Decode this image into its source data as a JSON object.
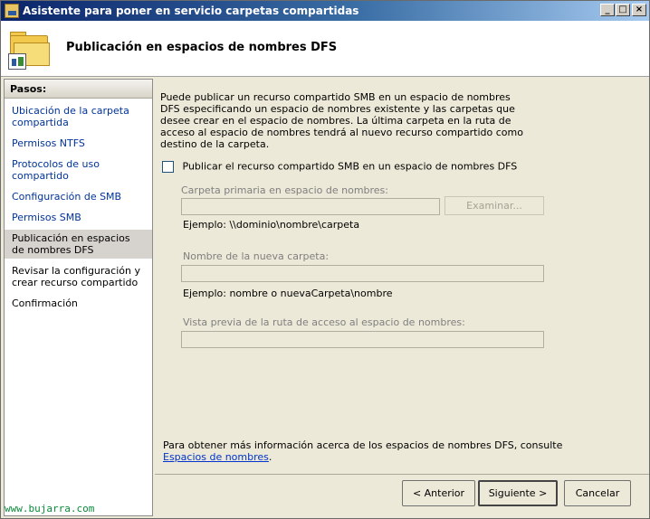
{
  "window": {
    "title": "Asistente para poner en servicio carpetas compartidas"
  },
  "header": {
    "title": "Publicación en espacios de nombres DFS"
  },
  "steps": {
    "heading": "Pasos:",
    "items": [
      {
        "label": "Ubicación de la carpeta compartida"
      },
      {
        "label": "Permisos NTFS"
      },
      {
        "label": "Protocolos de uso compartido"
      },
      {
        "label": "Configuración de SMB"
      },
      {
        "label": "Permisos SMB"
      },
      {
        "label": "Publicación en espacios de nombres DFS"
      },
      {
        "label": "Revisar la configuración y crear recurso compartido"
      },
      {
        "label": "Confirmación"
      }
    ]
  },
  "main": {
    "intro": "Puede publicar un recurso compartido SMB en un espacio de nombres DFS especificando un espacio de nombres existente y las carpetas que desee crear en el espacio de nombres. La última carpeta en la ruta de acceso al espacio de nombres tendrá al nuevo recurso compartido como destino de la carpeta.",
    "publish_checkbox": "Publicar el recurso compartido SMB en un espacio de nombres DFS",
    "parent_folder_label": "Carpeta primaria en espacio de nombres:",
    "browse_button": "Examinar...",
    "parent_example": "Ejemplo: \\\\dominio\\nombre\\carpeta",
    "new_folder_label": "Nombre de la nueva carpeta:",
    "new_folder_example": "Ejemplo: nombre o nuevaCarpeta\\nombre",
    "preview_label": "Vista previa de la ruta de acceso al espacio de nombres:",
    "more_info_text": "Para obtener más información acerca de los espacios de nombres DFS, consulte",
    "more_info_link": "Espacios de nombres",
    "more_info_end": "."
  },
  "footer": {
    "back": "< Anterior",
    "next": "Siguiente >",
    "cancel": "Cancelar"
  },
  "watermark": "www.bujarra.com"
}
